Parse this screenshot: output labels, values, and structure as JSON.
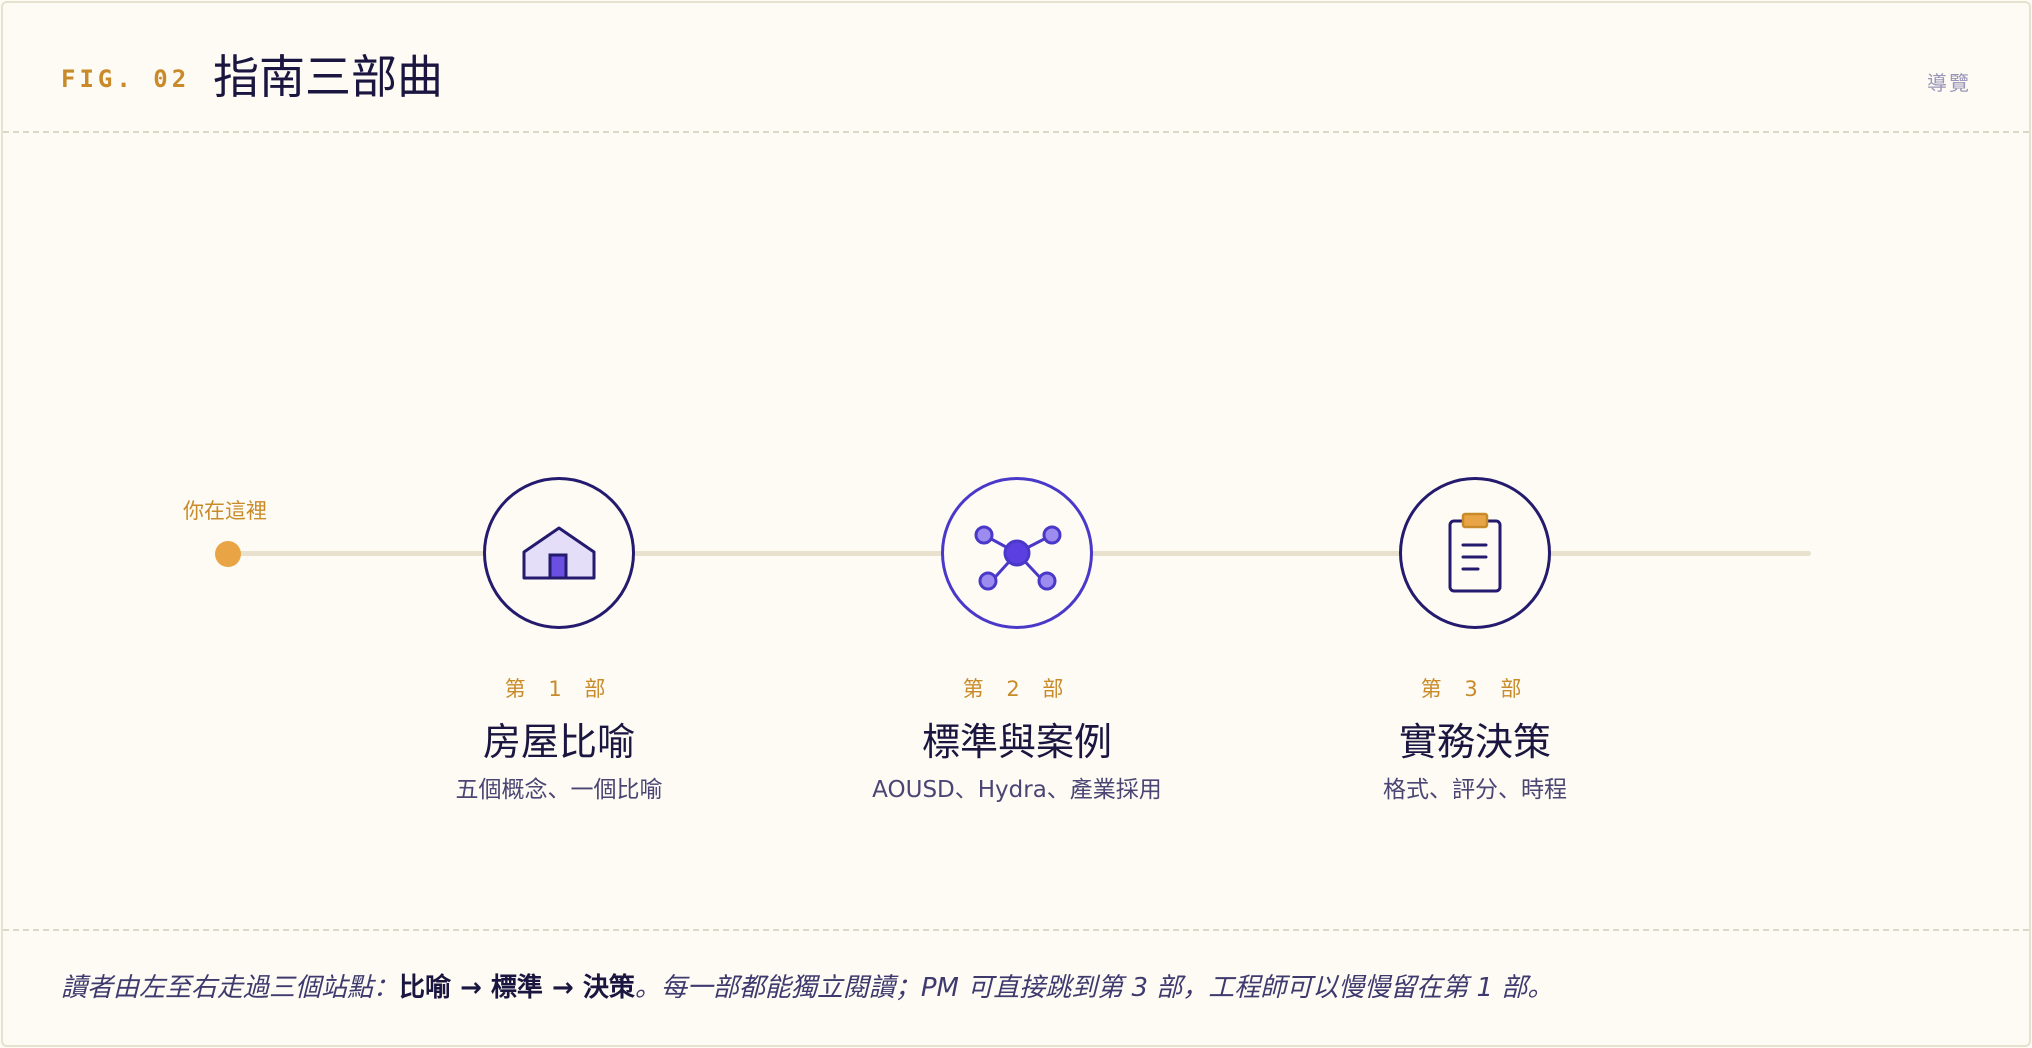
{
  "header": {
    "fig_label": "FIG. 02",
    "title": "指南三部曲",
    "nav": "導覽"
  },
  "timeline": {
    "current_label": "你在這裡"
  },
  "stations": [
    {
      "part": "第 1 部",
      "title": "房屋比喻",
      "desc": "五個概念、一個比喻",
      "icon": "house-icon"
    },
    {
      "part": "第 2 部",
      "title": "標準與案例",
      "desc": "AOUSD、Hydra、產業採用",
      "icon": "network-icon"
    },
    {
      "part": "第 3 部",
      "title": "實務決策",
      "desc": "格式、評分、時程",
      "icon": "clipboard-icon"
    }
  ],
  "footer": {
    "intro": "讀者由左至右走過三個站點：",
    "step1": "比喻",
    "arrow": " → ",
    "step2": "標準",
    "step3": "決策",
    "outro": "。每一部都能獨立閱讀；PM 可直接跳到第 3 部，工程師可以慢慢留在第 1 部。"
  },
  "colors": {
    "accent": "#e9a445",
    "primary": "#241a6e",
    "highlight": "#4a38c9",
    "background": "#fdfbf4"
  }
}
